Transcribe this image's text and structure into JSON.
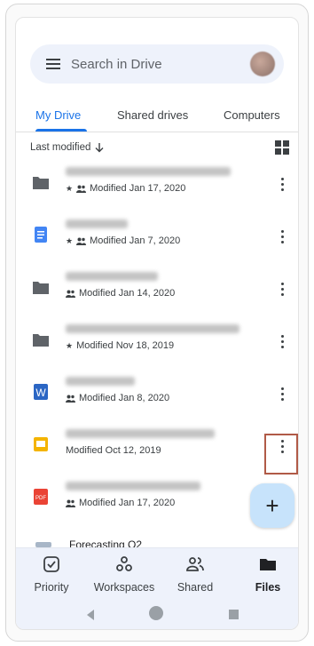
{
  "search": {
    "placeholder": "Search in Drive"
  },
  "tabs": [
    {
      "label": "My Drive",
      "active": true
    },
    {
      "label": "Shared drives",
      "active": false
    },
    {
      "label": "Computers",
      "active": false
    }
  ],
  "sort": {
    "label": "Last modified"
  },
  "files": [
    {
      "icon": "folder-icon",
      "starred": true,
      "shared": true,
      "modified": "Modified Jan 17, 2020"
    },
    {
      "icon": "docs-icon",
      "starred": true,
      "shared": true,
      "modified": "Modified Jan 7, 2020"
    },
    {
      "icon": "folder-icon",
      "starred": false,
      "shared": true,
      "modified": "Modified Jan 14, 2020"
    },
    {
      "icon": "folder-icon",
      "starred": true,
      "shared": false,
      "modified": "Modified Nov 18, 2019"
    },
    {
      "icon": "word-icon",
      "starred": false,
      "shared": true,
      "modified": "Modified Jan 8, 2020"
    },
    {
      "icon": "slides-icon",
      "starred": false,
      "shared": false,
      "modified": "Modified Oct 12, 2019"
    },
    {
      "icon": "pdf-icon",
      "starred": false,
      "shared": true,
      "modified": "Modified Jan 17, 2020"
    }
  ],
  "peek_file": {
    "title": "Forecasting Q2"
  },
  "fab": {
    "label": "+"
  },
  "bottom_nav": [
    {
      "label": "Priority",
      "icon": "priority-icon",
      "active": false
    },
    {
      "label": "Workspaces",
      "icon": "workspaces-icon",
      "active": false
    },
    {
      "label": "Shared",
      "icon": "shared-icon",
      "active": false
    },
    {
      "label": "Files",
      "icon": "files-icon",
      "active": true
    }
  ],
  "colors": {
    "accent": "#1a73e8",
    "folder": "#5f6368",
    "docs": "#4285f4",
    "word": "#2b66c4",
    "slides": "#f4b400",
    "pdf": "#ea4335",
    "highlight": "#b05a47"
  }
}
